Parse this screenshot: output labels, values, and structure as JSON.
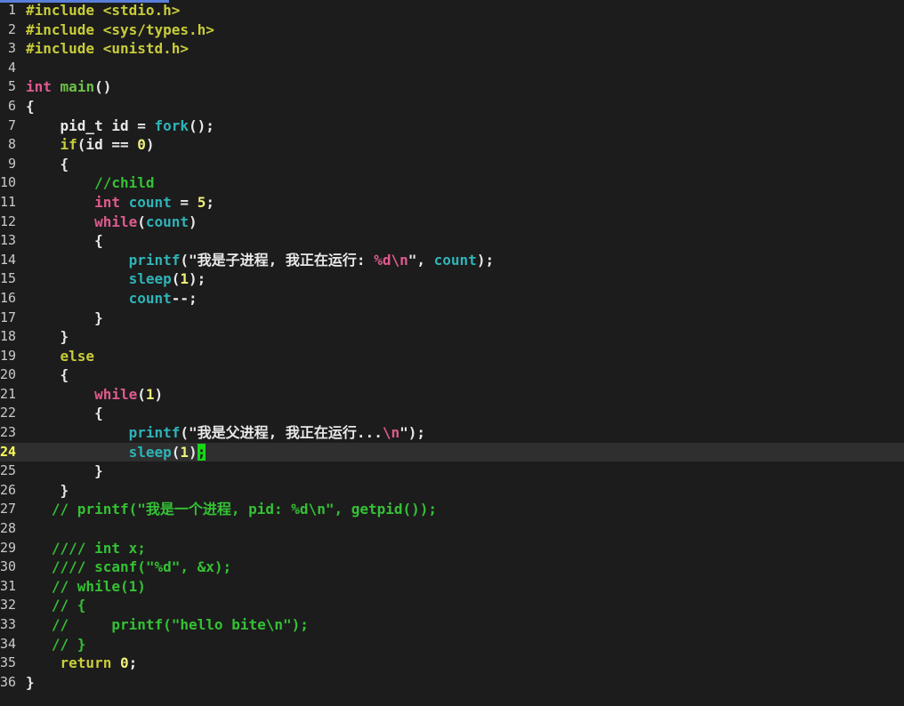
{
  "editor": {
    "current_line": 24,
    "lines": [
      {
        "n": "1",
        "tokens": [
          {
            "t": "#include <stdio.h>",
            "c": "pre"
          }
        ]
      },
      {
        "n": "2",
        "tokens": [
          {
            "t": "#include <sys/types.h>",
            "c": "pre"
          }
        ]
      },
      {
        "n": "3",
        "tokens": [
          {
            "t": "#include <unistd.h>",
            "c": "pre"
          }
        ]
      },
      {
        "n": "4",
        "tokens": []
      },
      {
        "n": "5",
        "tokens": [
          {
            "t": "int",
            "c": "kw"
          },
          {
            "t": " ",
            "c": "txt"
          },
          {
            "t": "main",
            "c": "type"
          },
          {
            "t": "()",
            "c": "txt"
          }
        ]
      },
      {
        "n": "6",
        "tokens": [
          {
            "t": "{",
            "c": "txt"
          }
        ]
      },
      {
        "n": "7",
        "tokens": [
          {
            "t": "    pid_t id = ",
            "c": "txt"
          },
          {
            "t": "fork",
            "c": "fn"
          },
          {
            "t": "();",
            "c": "txt"
          }
        ]
      },
      {
        "n": "8",
        "tokens": [
          {
            "t": "    ",
            "c": "txt"
          },
          {
            "t": "if",
            "c": "pre"
          },
          {
            "t": "(id == ",
            "c": "txt"
          },
          {
            "t": "0",
            "c": "num"
          },
          {
            "t": ")",
            "c": "txt"
          }
        ]
      },
      {
        "n": "9",
        "tokens": [
          {
            "t": "    {",
            "c": "txt"
          }
        ]
      },
      {
        "n": "10",
        "tokens": [
          {
            "t": "        //child",
            "c": "com"
          }
        ]
      },
      {
        "n": "11",
        "tokens": [
          {
            "t": "        ",
            "c": "txt"
          },
          {
            "t": "int",
            "c": "kw"
          },
          {
            "t": " ",
            "c": "txt"
          },
          {
            "t": "count",
            "c": "fn"
          },
          {
            "t": " = ",
            "c": "txt"
          },
          {
            "t": "5",
            "c": "num"
          },
          {
            "t": ";",
            "c": "txt"
          }
        ]
      },
      {
        "n": "12",
        "tokens": [
          {
            "t": "        ",
            "c": "txt"
          },
          {
            "t": "while",
            "c": "kw"
          },
          {
            "t": "(",
            "c": "txt"
          },
          {
            "t": "count",
            "c": "fn"
          },
          {
            "t": ")",
            "c": "txt"
          }
        ]
      },
      {
        "n": "13",
        "tokens": [
          {
            "t": "        {",
            "c": "txt"
          }
        ]
      },
      {
        "n": "14",
        "tokens": [
          {
            "t": "            ",
            "c": "txt"
          },
          {
            "t": "printf",
            "c": "fn"
          },
          {
            "t": "(\"我是子进程, 我正在运行: ",
            "c": "str"
          },
          {
            "t": "%d\\n",
            "c": "esc"
          },
          {
            "t": "\", ",
            "c": "str"
          },
          {
            "t": "count",
            "c": "fn"
          },
          {
            "t": ");",
            "c": "txt"
          }
        ]
      },
      {
        "n": "15",
        "tokens": [
          {
            "t": "            ",
            "c": "txt"
          },
          {
            "t": "sleep",
            "c": "fn"
          },
          {
            "t": "(",
            "c": "txt"
          },
          {
            "t": "1",
            "c": "num"
          },
          {
            "t": ");",
            "c": "txt"
          }
        ]
      },
      {
        "n": "16",
        "tokens": [
          {
            "t": "            ",
            "c": "txt"
          },
          {
            "t": "count",
            "c": "fn"
          },
          {
            "t": "--;",
            "c": "txt"
          }
        ]
      },
      {
        "n": "17",
        "tokens": [
          {
            "t": "        }",
            "c": "txt"
          }
        ]
      },
      {
        "n": "18",
        "tokens": [
          {
            "t": "    }",
            "c": "txt"
          }
        ]
      },
      {
        "n": "19",
        "tokens": [
          {
            "t": "    ",
            "c": "txt"
          },
          {
            "t": "else",
            "c": "pre"
          }
        ]
      },
      {
        "n": "20",
        "tokens": [
          {
            "t": "    {",
            "c": "txt"
          }
        ]
      },
      {
        "n": "21",
        "tokens": [
          {
            "t": "        ",
            "c": "txt"
          },
          {
            "t": "while",
            "c": "kw"
          },
          {
            "t": "(",
            "c": "txt"
          },
          {
            "t": "1",
            "c": "num"
          },
          {
            "t": ")",
            "c": "txt"
          }
        ]
      },
      {
        "n": "22",
        "tokens": [
          {
            "t": "        {",
            "c": "txt"
          }
        ]
      },
      {
        "n": "23",
        "tokens": [
          {
            "t": "            ",
            "c": "txt"
          },
          {
            "t": "printf",
            "c": "fn"
          },
          {
            "t": "(\"我是父进程, 我正在运行...",
            "c": "str"
          },
          {
            "t": "\\n",
            "c": "esc"
          },
          {
            "t": "\");",
            "c": "txt"
          }
        ]
      },
      {
        "n": "24",
        "tokens": [
          {
            "t": "            ",
            "c": "txt"
          },
          {
            "t": "sleep",
            "c": "fn"
          },
          {
            "t": "(",
            "c": "txt"
          },
          {
            "t": "1",
            "c": "num"
          },
          {
            "t": ")",
            "c": "txt"
          },
          {
            "t": ";",
            "c": "cursor"
          }
        ]
      },
      {
        "n": "25",
        "tokens": [
          {
            "t": "        }",
            "c": "txt"
          }
        ]
      },
      {
        "n": "26",
        "tokens": [
          {
            "t": "    }",
            "c": "txt"
          }
        ]
      },
      {
        "n": "27",
        "tokens": [
          {
            "t": "   // printf(\"我是一个进程, pid: %d\\n\", getpid());",
            "c": "com"
          }
        ]
      },
      {
        "n": "28",
        "tokens": []
      },
      {
        "n": "29",
        "tokens": [
          {
            "t": "   //// int x;",
            "c": "com"
          }
        ]
      },
      {
        "n": "30",
        "tokens": [
          {
            "t": "   //// scanf(\"%d\", &x);",
            "c": "com"
          }
        ]
      },
      {
        "n": "31",
        "tokens": [
          {
            "t": "   // while(1)",
            "c": "com"
          }
        ]
      },
      {
        "n": "32",
        "tokens": [
          {
            "t": "   // {",
            "c": "com"
          }
        ]
      },
      {
        "n": "33",
        "tokens": [
          {
            "t": "   //     printf(\"hello bite\\n\");",
            "c": "com"
          }
        ]
      },
      {
        "n": "34",
        "tokens": [
          {
            "t": "   // }",
            "c": "com"
          }
        ]
      },
      {
        "n": "35",
        "tokens": [
          {
            "t": "    ",
            "c": "txt"
          },
          {
            "t": "return",
            "c": "pre"
          },
          {
            "t": " ",
            "c": "txt"
          },
          {
            "t": "0",
            "c": "num"
          },
          {
            "t": ";",
            "c": "txt"
          }
        ]
      },
      {
        "n": "36",
        "tokens": [
          {
            "t": "}",
            "c": "txt"
          }
        ]
      }
    ]
  }
}
